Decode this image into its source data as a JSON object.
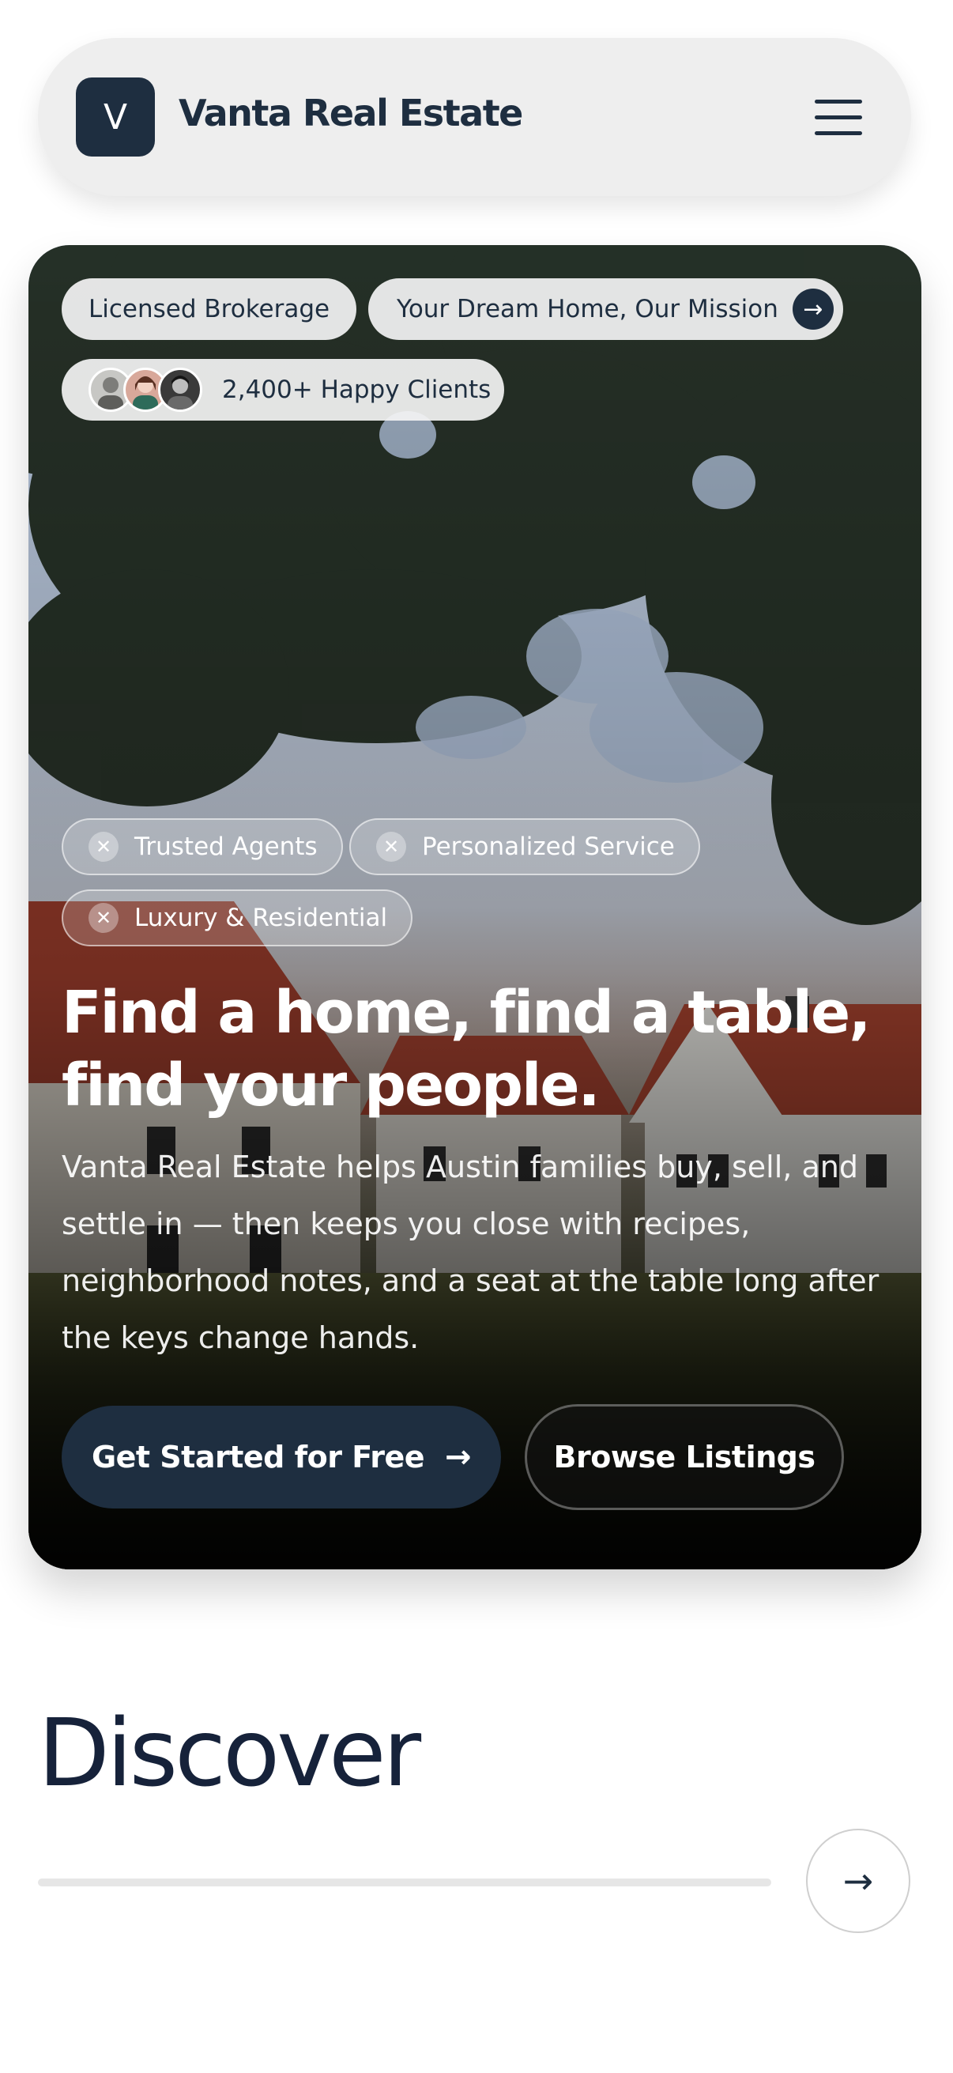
{
  "header": {
    "logo_letter": "V",
    "brand_name": "Vanta Real Estate"
  },
  "hero": {
    "badges": {
      "licensed": "Licensed Brokerage",
      "mission": "Your Dream Home, Our Mission",
      "clients": "2,400+ Happy Clients"
    },
    "tags": [
      "Trusted Agents",
      "Personalized Service",
      "Luxury & Residential"
    ],
    "title_line1": "Find a home, find a table,",
    "title_line2": "find your people.",
    "description": "Vanta Real Estate helps Austin families buy, sell, and settle in — then keeps you close with recipes, neighborhood notes, and a seat at the table long after the keys change hands.",
    "primary_cta": "Get Started for Free",
    "secondary_cta": "Browse Listings"
  },
  "discover": {
    "title": "Discover"
  },
  "colors": {
    "brand_navy": "#1e2e40",
    "header_bg": "#eeeeee",
    "track": "#e6e6e6"
  }
}
